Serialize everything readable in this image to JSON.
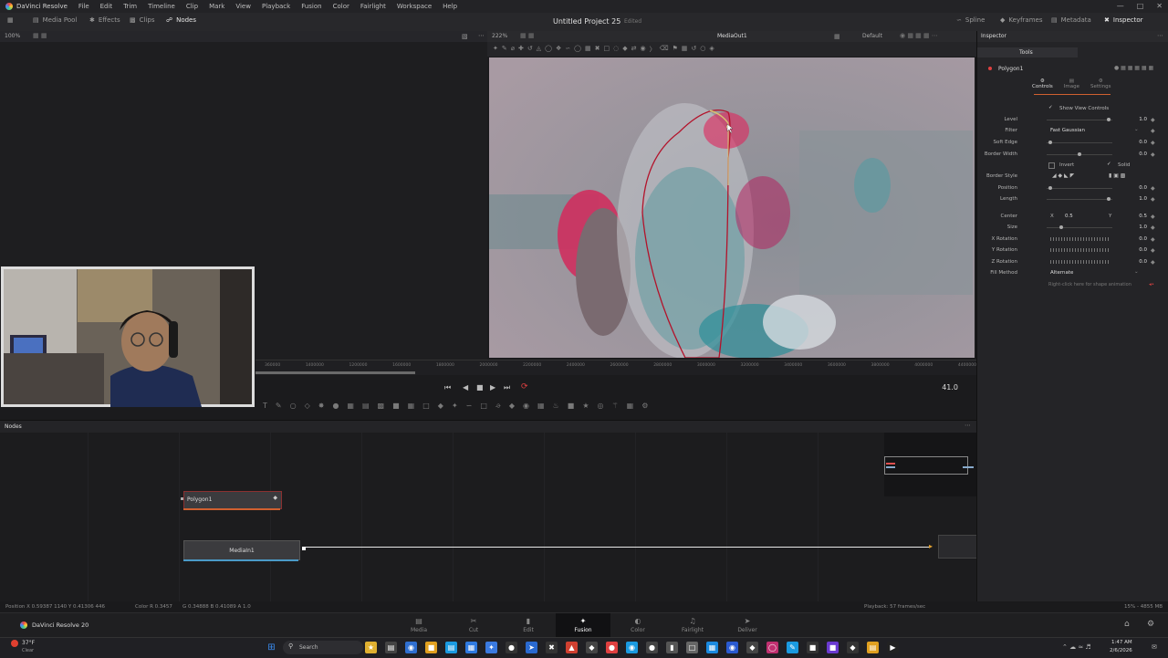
{
  "menubar": {
    "app_name": "DaVinci Resolve",
    "items": [
      "File",
      "Edit",
      "Trim",
      "Timeline",
      "Clip",
      "Mark",
      "View",
      "Playback",
      "Fusion",
      "Color",
      "Fairlight",
      "Workspace",
      "Help"
    ]
  },
  "toolbar": {
    "media_pool": "Media Pool",
    "effects": "Effects",
    "clips": "Clips",
    "nodes": "Nodes",
    "project_title": "Untitled Project 25",
    "edited": "Edited",
    "spline": "Spline",
    "keyframes": "Keyframes",
    "metadata": "Metadata",
    "inspector": "Inspector"
  },
  "left_zoom": "100%",
  "viewer": {
    "zoom": "222%",
    "name": "MediaOut1",
    "preset": "Default"
  },
  "ruler_ticks": [
    "360000",
    "1400000",
    "1200000",
    "1600000",
    "1800000",
    "2000000",
    "2200000",
    "2400000",
    "2600000",
    "2800000",
    "3000000",
    "3200000",
    "3400000",
    "3600000",
    "3800000",
    "4000000",
    "4400000"
  ],
  "transport": {
    "frame": "41.0"
  },
  "nodes_panel": {
    "title": "Nodes",
    "polygon_node": "Polygon1",
    "media_in_node": "MediaIn1"
  },
  "inspector": {
    "title": "Inspector",
    "tools_tab": "Tools",
    "node_name": "Polygon1",
    "tabs": [
      "Controls",
      "Image",
      "Settings"
    ],
    "show_view_controls": "Show View Controls",
    "level_label": "Level",
    "level": "1.0",
    "filter_label": "Filter",
    "filter": "Fast Gaussian",
    "soft_edge_label": "Soft Edge",
    "soft_edge": "0.0",
    "border_width_label": "Border Width",
    "border_width": "0.0",
    "invert": "Invert",
    "solid": "Solid",
    "border_style_label": "Border Style",
    "position_label": "Position",
    "position": "0.0",
    "length_label": "Length",
    "length": "1.0",
    "center_label": "Center",
    "center_x_label": "X",
    "center_x": "0.5",
    "center_y_label": "Y",
    "center_y": "0.5",
    "size_label": "Size",
    "size": "1.0",
    "x_rotation_label": "X Rotation",
    "x_rotation": "0.0",
    "y_rotation_label": "Y Rotation",
    "y_rotation": "0.0",
    "z_rotation_label": "Z Rotation",
    "z_rotation": "0.0",
    "fill_method_label": "Fill Method",
    "fill_method": "Alternate",
    "hint": "Right-click here for shape animation"
  },
  "status": {
    "position": "Position  X 0.59387   1140   Y 0.41306   446",
    "color": "Color  R 0.3457",
    "color2": "G 0.34888   B 0.41089   A 1.0",
    "playback": "Playback: 57 frames/sec",
    "memory": "15% - 4855 MB"
  },
  "pages": [
    "Media",
    "Cut",
    "Edit",
    "Fusion",
    "Color",
    "Fairlight",
    "Deliver"
  ],
  "active_page": "Fusion",
  "brand": "DaVinci Resolve 20",
  "taskbar": {
    "weather_temp": "37°F",
    "weather_text": "Clear",
    "search": "Search",
    "time": "1:47 AM",
    "date": "2/6/2026"
  }
}
